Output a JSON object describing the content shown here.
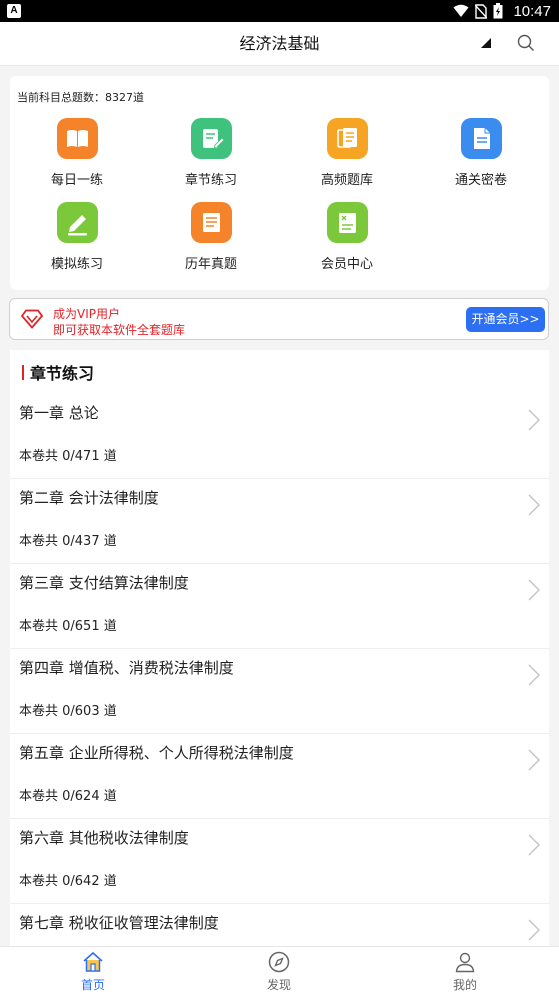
{
  "status_bar": {
    "app_badge": "A",
    "time": "10:47"
  },
  "header": {
    "title": "经济法基础"
  },
  "features": {
    "total_text": "当前科目总题数：8327道",
    "items": [
      {
        "label": "每日一练",
        "color": "#f5832a"
      },
      {
        "label": "章节练习",
        "color": "#3fc27e"
      },
      {
        "label": "高频题库",
        "color": "#f6a423"
      },
      {
        "label": "通关密卷",
        "color": "#3a8def"
      },
      {
        "label": "模拟练习",
        "color": "#7bc83b"
      },
      {
        "label": "历年真题",
        "color": "#f5832a"
      },
      {
        "label": "会员中心",
        "color": "#7bc83b"
      }
    ]
  },
  "vip": {
    "line1": "成为VIP用户",
    "line2": "即可获取本软件全套题库",
    "button": "开通会员>>",
    "accent": "#e0242a",
    "button_color": "#2c6ff2"
  },
  "chapters": {
    "title": "章节练习",
    "items": [
      {
        "name": "第一章 总论",
        "count": "本卷共 0/471 道"
      },
      {
        "name": "第二章 会计法律制度",
        "count": "本卷共 0/437 道"
      },
      {
        "name": "第三章 支付结算法律制度",
        "count": "本卷共 0/651 道"
      },
      {
        "name": "第四章 增值税、消费税法律制度",
        "count": "本卷共 0/603 道"
      },
      {
        "name": "第五章 企业所得税、个人所得税法律制度",
        "count": "本卷共 0/624 道"
      },
      {
        "name": "第六章 其他税收法律制度",
        "count": "本卷共 0/642 道"
      },
      {
        "name": "第七章 税收征收管理法律制度",
        "count": ""
      }
    ]
  },
  "bottom_nav": {
    "items": [
      {
        "label": "首页",
        "icon": "home-icon"
      },
      {
        "label": "发现",
        "icon": "compass-icon"
      },
      {
        "label": "我的",
        "icon": "profile-icon"
      }
    ]
  }
}
